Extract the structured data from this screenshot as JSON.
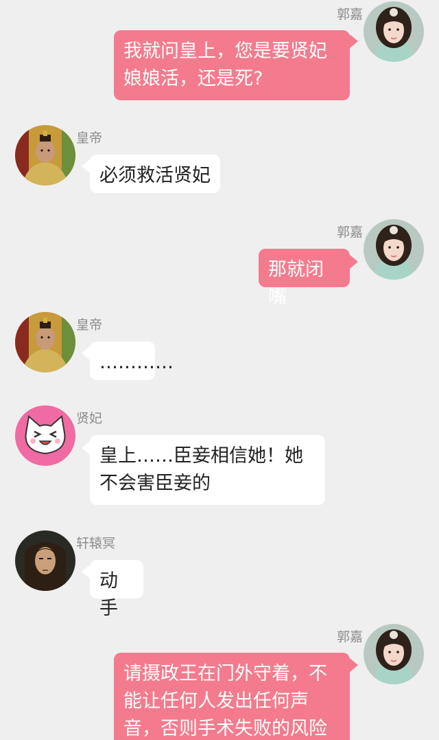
{
  "messages": [
    {
      "sender": "郭嘉",
      "text": "我就问皇上，您是要贤妃娘娘活，还是死?"
    },
    {
      "sender": "皇帝",
      "text": "必须救活贤妃"
    },
    {
      "sender": "郭嘉",
      "text": "那就闭嘴"
    },
    {
      "sender": "皇帝",
      "text": "…………"
    },
    {
      "sender": "贤妃",
      "text": "皇上……臣妾相信她！她不会害臣妾的"
    },
    {
      "sender": "轩辕冥",
      "text": "动手"
    },
    {
      "sender": "郭嘉",
      "text": "请摄政王在门外守着，不能让任何人发出任何声音，否则手术失败的风险"
    }
  ],
  "colors": {
    "background": "#efefef",
    "outgoing_bubble": "#f47b8d",
    "incoming_bubble": "#ffffff",
    "sender_name": "#8c8c8c"
  },
  "icons": {
    "guojia_avatar": "woman-portrait-avatar",
    "emperor_avatar": "emperor-portrait-avatar",
    "xianfei_avatar": "laughing-cat-avatar",
    "xuanyuanming_avatar": "man-portrait-avatar"
  }
}
